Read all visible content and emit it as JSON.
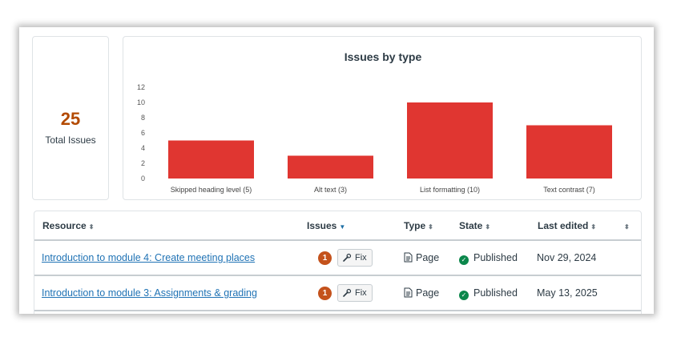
{
  "summary": {
    "total_count": "25",
    "total_label": "Total Issues"
  },
  "chart_data": {
    "type": "bar",
    "title": "Issues by type",
    "categories": [
      "Skipped heading level (5)",
      "Alt text (3)",
      "List formatting (10)",
      "Text contrast (7)"
    ],
    "values": [
      5,
      3,
      10,
      7
    ],
    "ylim": [
      0,
      12
    ],
    "yticks": [
      0,
      2,
      4,
      6,
      8,
      10,
      12
    ],
    "xlabel": "",
    "ylabel": "",
    "grid": false,
    "bar_color": "#e03631"
  },
  "table": {
    "headers": {
      "resource": "Resource",
      "issues": "Issues",
      "type": "Type",
      "state": "State",
      "last_edited": "Last edited"
    },
    "rows": [
      {
        "resource": "Introduction to module 4: Create meeting places",
        "issues": "1",
        "fix_label": "Fix",
        "type": "Page",
        "state": "Published",
        "last_edited": "Nov 29, 2024"
      },
      {
        "resource": "Introduction to module 3: Assignments & grading",
        "issues": "1",
        "fix_label": "Fix",
        "type": "Page",
        "state": "Published",
        "last_edited": "May 13, 2025"
      }
    ]
  },
  "colors": {
    "accent_issue": "#b34a00",
    "badge": "#c4521c",
    "published": "#0b874b",
    "link": "#2073b5"
  }
}
